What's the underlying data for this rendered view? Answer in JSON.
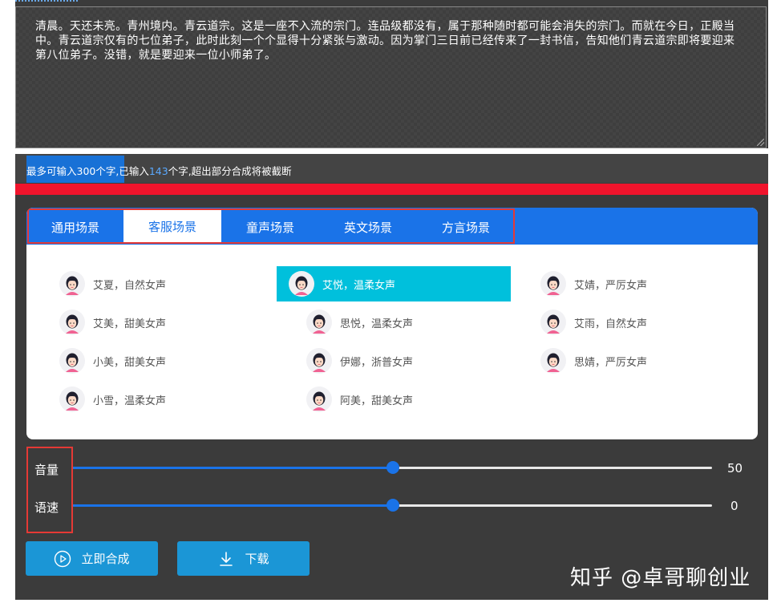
{
  "editor": {
    "text": "清晨。天还未亮。青州境内。青云道宗。这是一座不入流的宗门。连品级都没有，属于那种随时都可能会消失的宗门。而就在今日，正殿当中。青云道宗仅有的七位弟子，此时此刻一个个显得十分紧张与激动。因为掌门三日前已经传来了一封书信，告知他们青云道宗即将要迎来第八位弟子。没错，就是要迎来一位小师弟了。"
  },
  "info": {
    "prefix": "最多可输入300个字,已输入",
    "count": "143",
    "suffix": "个字,超出部分合成将被截断"
  },
  "tabs": [
    "通用场景",
    "客服场景",
    "童声场景",
    "英文场景",
    "方言场景"
  ],
  "active_tab": "客服场景",
  "voices": {
    "col1": [
      "艾夏，自然女声",
      "艾美，甜美女声",
      "小美，甜美女声",
      "小雪，温柔女声"
    ],
    "col2": [
      "艾悦，温柔女声",
      "思悦，温柔女声",
      "伊娜，浙普女声",
      "阿美，甜美女声"
    ],
    "col3": [
      "艾婧，严厉女声",
      "艾雨，自然女声",
      "思婧，严厉女声"
    ]
  },
  "selected_voice": "艾悦，温柔女声",
  "controls": {
    "volume": {
      "label": "音量",
      "value": "50",
      "position": 0.5
    },
    "speed": {
      "label": "语速",
      "value": "0",
      "position": 0.5
    }
  },
  "buttons": {
    "synthesize": "立即合成",
    "download": "下载"
  },
  "watermark": "知乎 @卓哥聊创业",
  "colors": {
    "accent": "#1a73e8",
    "selected": "#00c0dc",
    "highlight_red": "#f0142c",
    "button": "#1b96d6"
  }
}
